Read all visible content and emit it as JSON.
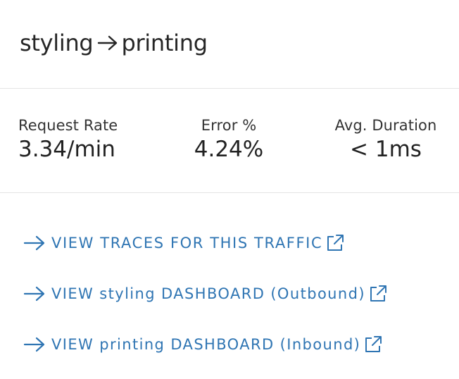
{
  "header": {
    "source": "styling",
    "target": "printing"
  },
  "metrics": [
    {
      "label": "Request Rate",
      "value": "3.34/min"
    },
    {
      "label": "Error %",
      "value": "4.24%"
    },
    {
      "label": "Avg. Duration",
      "value": "< 1ms"
    }
  ],
  "links": [
    {
      "label": "VIEW TRACES FOR THIS TRAFFIC"
    },
    {
      "label": "VIEW styling DASHBOARD (Outbound)"
    },
    {
      "label": "VIEW printing DASHBOARD (Inbound)"
    }
  ],
  "colors": {
    "link": "#2f75b3",
    "divider": "#e4e4e4",
    "text": "#222222"
  },
  "icons": {
    "header_arrow": "arrow-right-icon",
    "link_arrow": "arrow-right-icon",
    "external": "external-link-icon"
  }
}
